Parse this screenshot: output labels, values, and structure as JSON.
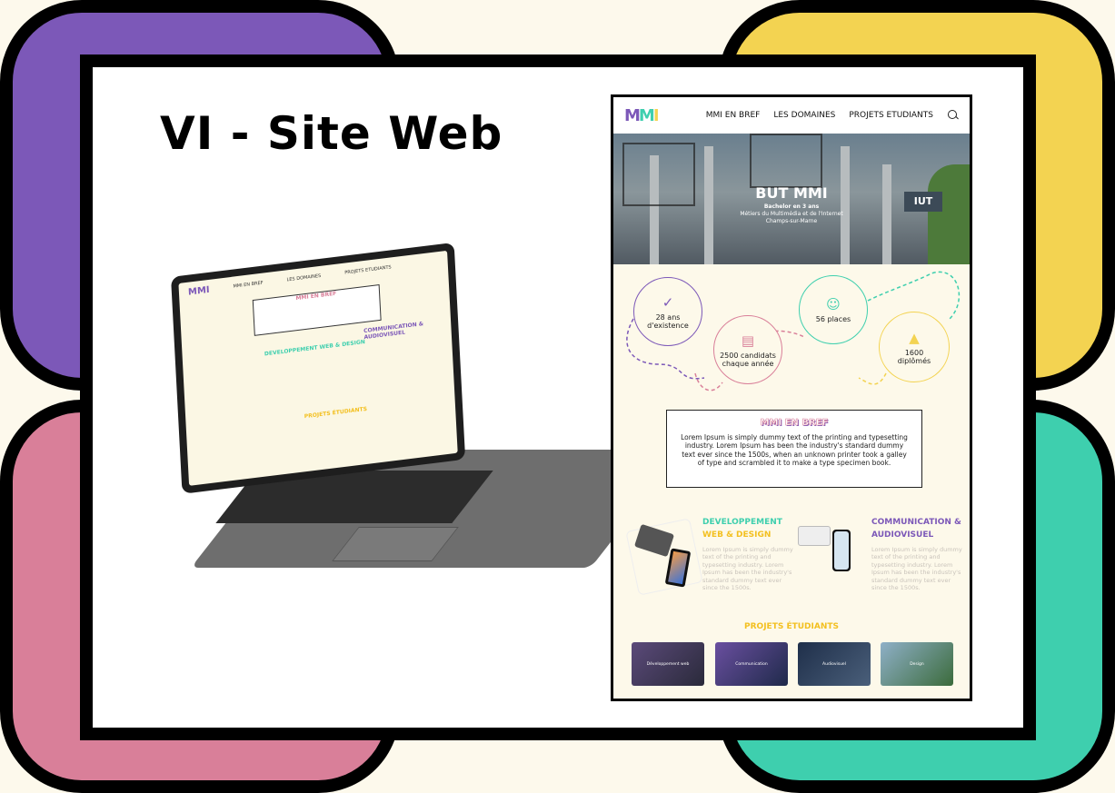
{
  "slide": {
    "title": "VI - Site Web",
    "colors": {
      "purple": "#7c58b8",
      "yellow": "#f3d351",
      "pink": "#d97f99",
      "green": "#3ecfae"
    }
  },
  "laptop_preview": {
    "nav": [
      "MMI EN BREF",
      "LES DOMAINES",
      "PROJETS ETUDIANTS"
    ],
    "about_title": "MMI EN BREF",
    "domain_1": "DEVELOPPEMENT WEB & DESIGN",
    "domain_2": "COMMUNICATION & AUDIOVISUEL",
    "projects_title": "PROJETS ÉTUDIANTS"
  },
  "site": {
    "logo": {
      "m1": "M",
      "m2": "M",
      "i": "I"
    },
    "nav": {
      "item_1": "MMI EN BREF",
      "item_2": "LES DOMAINES",
      "item_3": "PROJETS ETUDIANTS",
      "search_icon": "search-icon"
    },
    "hero": {
      "title": "BUT MMI",
      "subtitle": "Bachelor en 3 ans",
      "line_1": "Métiers du Multimédia et de l'Internet",
      "line_2": "Champs-sur-Marne",
      "sign": "IUT"
    },
    "stats": {
      "s1": {
        "value": "28 ans",
        "label": "d'existence",
        "icon": "check-circle-icon"
      },
      "s2": {
        "value": "2500 candidats",
        "label": "chaque année",
        "icon": "clipboard-icon"
      },
      "s3": {
        "value": "56 places",
        "label": "",
        "icon": "group-icon"
      },
      "s4": {
        "value": "1600",
        "label": "diplômés",
        "icon": "graduation-cap-icon"
      }
    },
    "about": {
      "title": "MMI EN BREF",
      "text": "Lorem Ipsum is simply dummy text of the printing and typesetting industry. Lorem Ipsum has been the industry's standard dummy text ever since the 1500s, when an unknown printer took a galley of type and scrambled it to make a type specimen book."
    },
    "domains": {
      "dev": {
        "title_1": "DEVELOPPEMENT",
        "title_2": "WEB & DESIGN",
        "text": "Lorem Ipsum is simply dummy text of the printing and typesetting industry. Lorem Ipsum has been the industry's standard dummy text ever since the 1500s."
      },
      "com": {
        "title_1": "COMMUNICATION &",
        "title_2": "AUDIOVISUEL",
        "text": "Lorem Ipsum is simply dummy text of the printing and typesetting industry. Lorem Ipsum has been the industry's standard dummy text ever since the 1500s."
      }
    },
    "projects": {
      "title": "PROJETS ÉTUDIANTS",
      "items": [
        "Développement web",
        "Communication",
        "Audiovisuel",
        "Design"
      ]
    }
  }
}
